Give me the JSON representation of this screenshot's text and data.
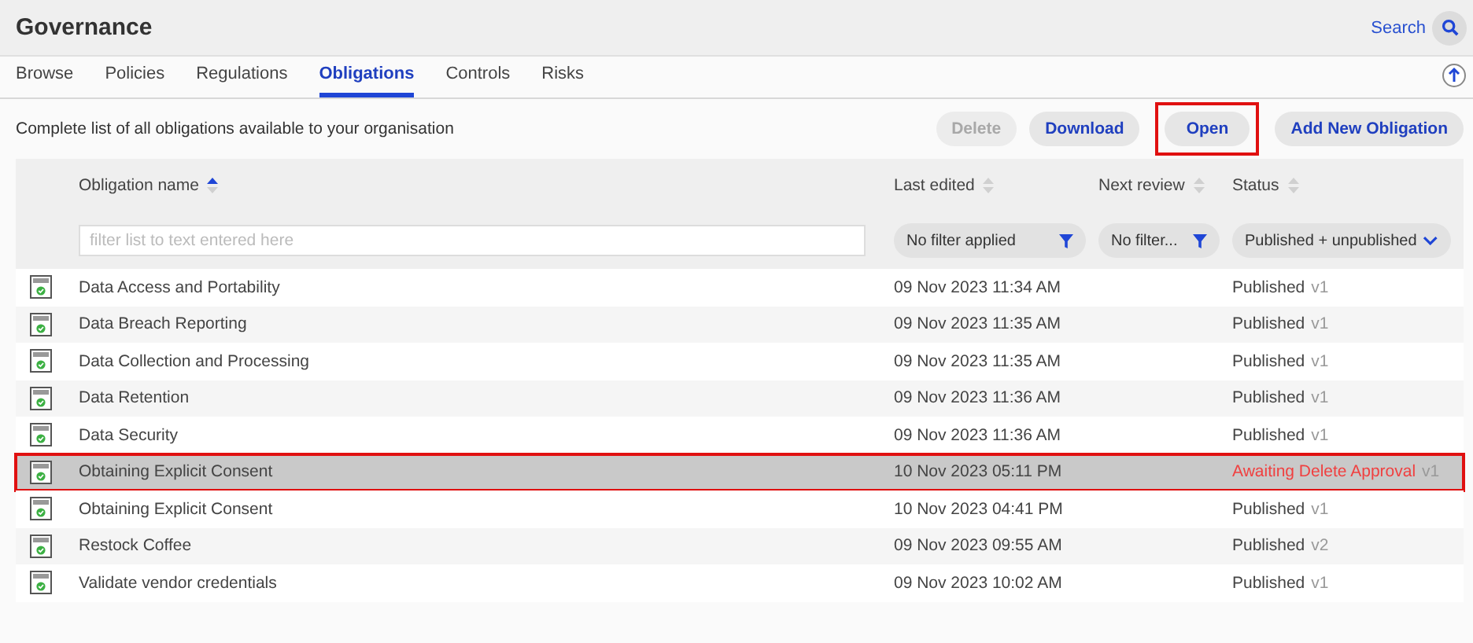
{
  "header": {
    "title": "Governance",
    "search_label": "Search"
  },
  "tabs": [
    {
      "label": "Browse",
      "selected": false
    },
    {
      "label": "Policies",
      "selected": false
    },
    {
      "label": "Regulations",
      "selected": false
    },
    {
      "label": "Obligations",
      "selected": true
    },
    {
      "label": "Controls",
      "selected": false
    },
    {
      "label": "Risks",
      "selected": false
    }
  ],
  "toolbar": {
    "description": "Complete list of all obligations available to your organisation",
    "buttons": [
      {
        "label": "Delete",
        "disabled": true,
        "highlighted": false
      },
      {
        "label": "Download",
        "disabled": false,
        "highlighted": false
      },
      {
        "label": "Open",
        "disabled": false,
        "highlighted": true
      },
      {
        "label": "Add New Obligation",
        "disabled": false,
        "highlighted": false
      }
    ]
  },
  "table": {
    "columns": [
      {
        "label": "Obligation name",
        "sorted": true
      },
      {
        "label": "Last edited",
        "sorted": false
      },
      {
        "label": "Next review",
        "sorted": false
      },
      {
        "label": "Status",
        "sorted": false
      }
    ],
    "filters": {
      "name_placeholder": "filter list to text entered here",
      "last_edited": "No filter applied",
      "next_review": "No filter...",
      "status": "Published + unpublished"
    },
    "rows": [
      {
        "name": "Data Access and Portability",
        "last_edited": "09 Nov 2023 11:34 AM",
        "status": "Published",
        "kind": "normal",
        "version": "v1",
        "selected": false
      },
      {
        "name": "Data Breach Reporting",
        "last_edited": "09 Nov 2023 11:35 AM",
        "status": "Published",
        "kind": "normal",
        "version": "v1",
        "selected": false
      },
      {
        "name": "Data Collection and Processing",
        "last_edited": "09 Nov 2023 11:35 AM",
        "status": "Published",
        "kind": "normal",
        "version": "v1",
        "selected": false
      },
      {
        "name": "Data Retention",
        "last_edited": "09 Nov 2023 11:36 AM",
        "status": "Published",
        "kind": "normal",
        "version": "v1",
        "selected": false
      },
      {
        "name": "Data Security",
        "last_edited": "09 Nov 2023 11:36 AM",
        "status": "Published",
        "kind": "normal",
        "version": "v1",
        "selected": false
      },
      {
        "name": "Obtaining Explicit Consent",
        "last_edited": "10 Nov 2023 05:11 PM",
        "status": "Awaiting Delete Approval",
        "kind": "alert",
        "version": "v1",
        "selected": true
      },
      {
        "name": "Obtaining Explicit Consent",
        "last_edited": "10 Nov 2023 04:41 PM",
        "status": "Published",
        "kind": "normal",
        "version": "v1",
        "selected": false
      },
      {
        "name": "Restock Coffee",
        "last_edited": "09 Nov 2023 09:55 AM",
        "status": "Published",
        "kind": "normal",
        "version": "v2",
        "selected": false
      },
      {
        "name": "Validate vendor credentials",
        "last_edited": "09 Nov 2023 10:02 AM",
        "status": "Published",
        "kind": "normal",
        "version": "v1",
        "selected": false
      }
    ]
  }
}
